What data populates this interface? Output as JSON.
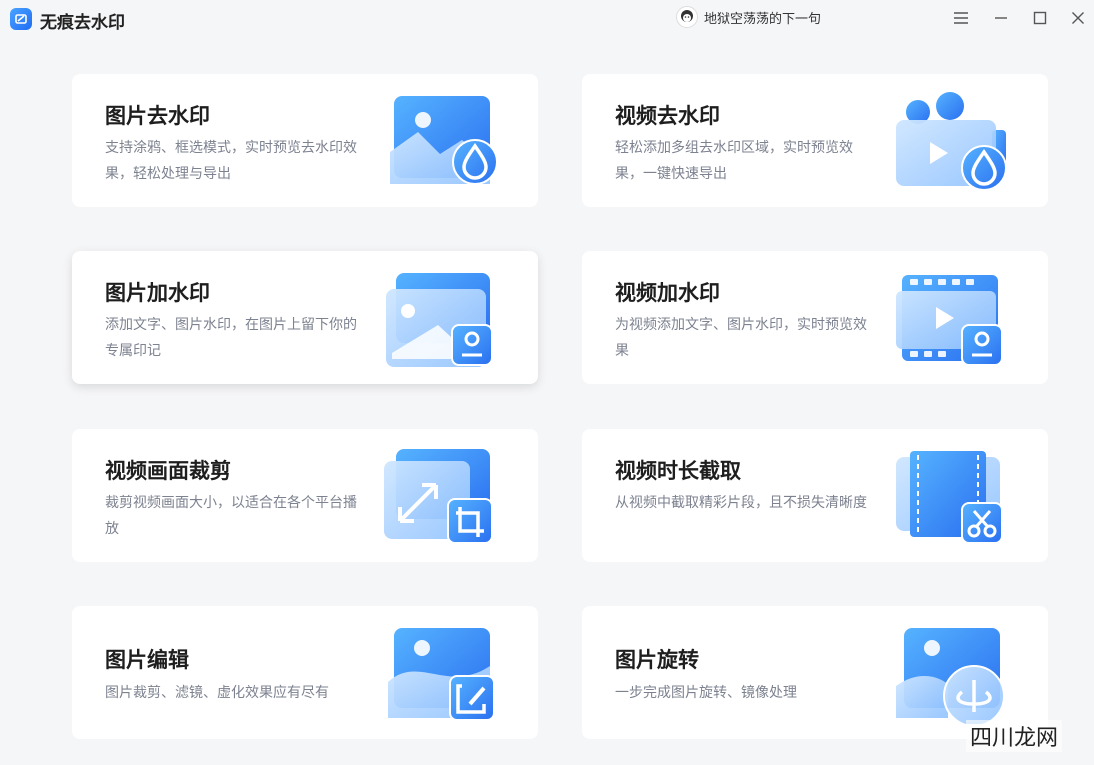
{
  "app": {
    "title": "无痕去水印",
    "user_name": "地狱空荡荡的下一句"
  },
  "window_controls": [
    "menu-icon",
    "minimize-icon",
    "maximize-icon",
    "close-icon"
  ],
  "cards": [
    {
      "title": "图片去水印",
      "desc": "支持涂鸦、框选模式，实时预览去水印效果，轻松处理与导出",
      "icon": "image-remove-watermark-icon"
    },
    {
      "title": "视频去水印",
      "desc": "轻松添加多组去水印区域，实时预览效果，一键快速导出",
      "icon": "video-remove-watermark-icon"
    },
    {
      "title": "图片加水印",
      "desc": "添加文字、图片水印，在图片上留下你的专属印记",
      "icon": "image-add-watermark-icon"
    },
    {
      "title": "视频加水印",
      "desc": "为视频添加文字、图片水印，实时预览效果",
      "icon": "video-add-watermark-icon"
    },
    {
      "title": "视频画面裁剪",
      "desc": "裁剪视频画面大小，以适合在各个平台播放",
      "icon": "video-crop-icon"
    },
    {
      "title": "视频时长截取",
      "desc": "从视频中截取精彩片段，且不损失清晰度",
      "icon": "video-trim-icon"
    },
    {
      "title": "图片编辑",
      "desc": "图片裁剪、滤镜、虚化效果应有尽有",
      "icon": "image-edit-icon"
    },
    {
      "title": "图片旋转",
      "desc": "一步完成图片旋转、镜像处理",
      "icon": "image-rotate-icon"
    }
  ],
  "watermark": "四川龙网",
  "colors": {
    "accent": "#2f7bf5",
    "card_bg": "#ffffff",
    "page_bg": "#f5f6f8"
  }
}
